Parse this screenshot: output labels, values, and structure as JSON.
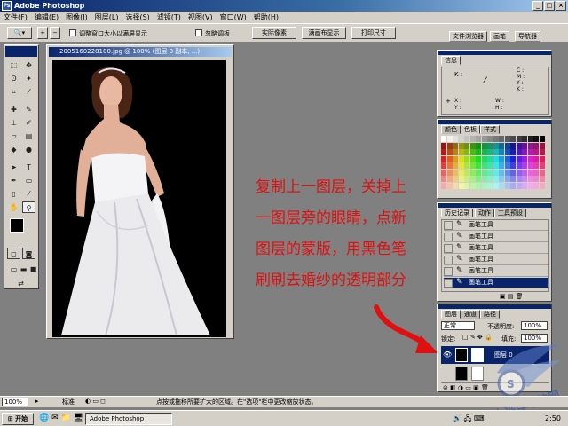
{
  "window": {
    "title": "Adobe Photoshop"
  },
  "menu": [
    "文件(F)",
    "编辑(E)",
    "图像(I)",
    "图层(L)",
    "选择(S)",
    "滤镜(T)",
    "视图(V)",
    "窗口(W)",
    "帮助(H)"
  ],
  "options": {
    "resize_label": "调整窗口大小以满屏显示",
    "ignore_palettes_label": "忽略调板",
    "actual_pixels": "实际像素",
    "fit_screen": "满画布显示",
    "print_size": "打印尺寸",
    "tabs": [
      "文件浏览器",
      "画笔",
      "导航器"
    ]
  },
  "document": {
    "title": "2005160228100.jpg @ 100% (图层 0 副本, ...)"
  },
  "annotation": {
    "lines": [
      "复制上一图层，关掉上",
      "一图层旁的眼睛，点新",
      "图层的蒙版，用黑色笔",
      "刷刷去婚纱的透明部分"
    ]
  },
  "info_palette": {
    "tab": "信息",
    "k_label": "K :",
    "cmyk_label": "C :\nM :\nY :\nK :",
    "x_label": "X :",
    "y_label": "Y :",
    "w_label": "W :",
    "h_label": "H :"
  },
  "swatch_palette": {
    "tabs": [
      "颜色",
      "色板",
      "样式"
    ]
  },
  "history_palette": {
    "tabs": [
      "历史记录",
      "动作",
      "工具预设"
    ],
    "items": [
      "画笔工具",
      "画笔工具",
      "画笔工具",
      "画笔工具",
      "画笔工具",
      "画笔工具"
    ]
  },
  "layers_palette": {
    "tabs": [
      "图层",
      "通道",
      "路径"
    ],
    "blend_mode": "正常",
    "opacity_label": "不透明度:",
    "opacity_value": "100%",
    "lock_label": "锁定:",
    "fill_label": "填充:",
    "fill_value": "100%",
    "layer_name": "图层 0"
  },
  "statusbar": {
    "zoom": "100%",
    "hint": "点按或拖移所要扩大的区域。在\"选项\"栏中更改缩放状态。",
    "mode": "标准"
  },
  "taskbar": {
    "start": "开始",
    "app": "Adobe Photoshop",
    "time": "2:50"
  },
  "watermark": {
    "text": "太平洋电脑网"
  }
}
